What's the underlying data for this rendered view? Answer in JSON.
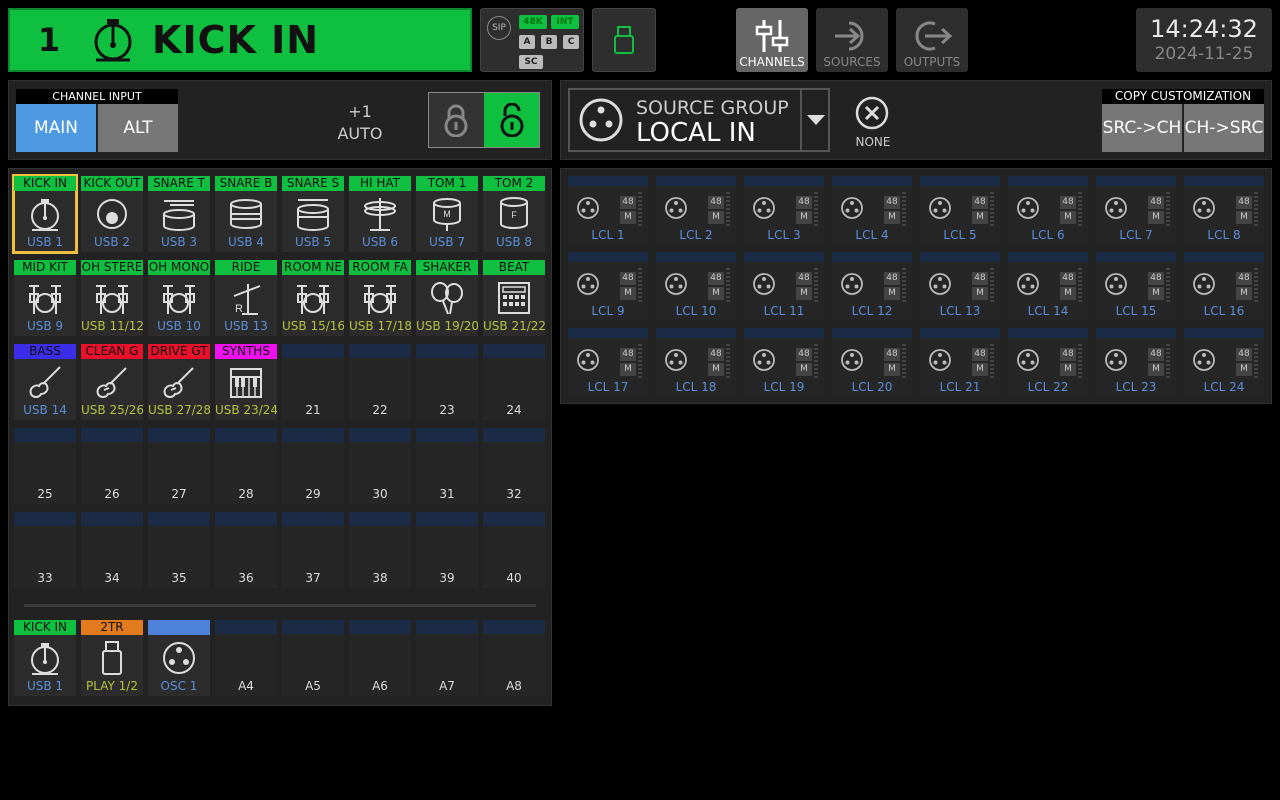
{
  "header": {
    "channel_number": "1",
    "channel_name": "KICK IN",
    "channel_icon": "kick-drum-icon",
    "sip": {
      "label": "SIP",
      "rate": "48K",
      "clock": "INT",
      "a": "A",
      "b": "B",
      "c": "C",
      "sc": "SC"
    },
    "nav": [
      {
        "label": "CHANNELS",
        "icon": "faders-icon",
        "active": true
      },
      {
        "label": "SOURCES",
        "icon": "source-arrow-icon",
        "active": false
      },
      {
        "label": "OUTPUTS",
        "icon": "output-arrow-icon",
        "active": false
      }
    ],
    "time": "14:24:32",
    "date": "2024-11-25"
  },
  "channel_input": {
    "label": "CHANNEL INPUT",
    "main": "MAIN",
    "alt": "ALT",
    "trim": "+1",
    "mode": "AUTO"
  },
  "source_group": {
    "label": "SOURCE GROUP",
    "value": "LOCAL IN",
    "none": "NONE"
  },
  "copy": {
    "label": "COPY CUSTOMIZATION",
    "src_to_ch": "SRC->CH",
    "ch_to_src": "CH->SRC"
  },
  "channels": [
    {
      "name": "KICK IN",
      "source": "USB 1",
      "color": "#0fbf3f",
      "icon": "kick-drum-icon",
      "selected": true
    },
    {
      "name": "KICK OUT",
      "source": "USB 2",
      "color": "#0fbf3f",
      "icon": "kick-drum-out-icon"
    },
    {
      "name": "SNARE T",
      "source": "USB 3",
      "color": "#0fbf3f",
      "icon": "snare-top-icon"
    },
    {
      "name": "SNARE B",
      "source": "USB 4",
      "color": "#0fbf3f",
      "icon": "snare-bottom-icon"
    },
    {
      "name": "SNARE S",
      "source": "USB 5",
      "color": "#0fbf3f",
      "icon": "snare-side-icon"
    },
    {
      "name": "HI HAT",
      "source": "USB 6",
      "color": "#0fbf3f",
      "icon": "hihat-icon"
    },
    {
      "name": "TOM 1",
      "source": "USB 7",
      "color": "#0fbf3f",
      "icon": "tom-m-icon"
    },
    {
      "name": "TOM 2",
      "source": "USB 8",
      "color": "#0fbf3f",
      "icon": "tom-f-icon"
    },
    {
      "name": "MID KIT",
      "source": "USB 9",
      "color": "#0fbf3f",
      "icon": "drumkit-icon"
    },
    {
      "name": "OH STERE",
      "source": "USB 11/12",
      "color": "#0fbf3f",
      "icon": "drumkit-icon",
      "stereo": true
    },
    {
      "name": "OH MONO",
      "source": "USB 10",
      "color": "#0fbf3f",
      "icon": "drumkit-icon"
    },
    {
      "name": "RIDE",
      "source": "USB 13",
      "color": "#0fbf3f",
      "icon": "ride-cymbal-icon"
    },
    {
      "name": "ROOM NE",
      "source": "USB 15/16",
      "color": "#0fbf3f",
      "icon": "drumkit-icon",
      "stereo": true
    },
    {
      "name": "ROOM FA",
      "source": "USB 17/18",
      "color": "#0fbf3f",
      "icon": "drumkit-icon",
      "stereo": true
    },
    {
      "name": "SHAKER",
      "source": "USB 19/20",
      "color": "#0fbf3f",
      "icon": "maracas-icon",
      "stereo": true
    },
    {
      "name": "BEAT",
      "source": "USB 21/22",
      "color": "#0fbf3f",
      "icon": "drum-machine-icon",
      "stereo": true
    },
    {
      "name": "BASS",
      "source": "USB 14",
      "color": "#3b2de8",
      "icon": "bass-guitar-icon"
    },
    {
      "name": "CLEAN G",
      "source": "USB 25/26",
      "color": "#e8102a",
      "icon": "electric-guitar-icon",
      "stereo": true
    },
    {
      "name": "DRIVE GT",
      "source": "USB 27/28",
      "color": "#e8102a",
      "icon": "electric-guitar-icon",
      "stereo": true
    },
    {
      "name": "SYNTHS",
      "source": "USB 23/24",
      "color": "#ee10ee",
      "icon": "keyboard-icon",
      "stereo": true
    },
    {
      "number": "21"
    },
    {
      "number": "22"
    },
    {
      "number": "23"
    },
    {
      "number": "24"
    },
    {
      "number": "25"
    },
    {
      "number": "26"
    },
    {
      "number": "27"
    },
    {
      "number": "28"
    },
    {
      "number": "29"
    },
    {
      "number": "30"
    },
    {
      "number": "31"
    },
    {
      "number": "32"
    },
    {
      "number": "33"
    },
    {
      "number": "34"
    },
    {
      "number": "35"
    },
    {
      "number": "36"
    },
    {
      "number": "37"
    },
    {
      "number": "38"
    },
    {
      "number": "39"
    },
    {
      "number": "40"
    }
  ],
  "aux_channels": [
    {
      "name": "KICK IN",
      "source": "USB 1",
      "color": "#0fbf3f",
      "icon": "kick-drum-icon"
    },
    {
      "name": "2TR",
      "source": "PLAY 1/2",
      "color": "#e27a1e",
      "icon": "usb-stick-icon",
      "stereo": true
    },
    {
      "name": "",
      "source": "OSC 1",
      "color": "#4d82d8",
      "icon": "xlr-icon"
    },
    {
      "number": "A4"
    },
    {
      "number": "A5"
    },
    {
      "number": "A6"
    },
    {
      "number": "A7"
    },
    {
      "number": "A8"
    }
  ],
  "sources": {
    "phantom_label": "48",
    "mute_label": "M",
    "items": [
      "LCL 1",
      "LCL 2",
      "LCL 3",
      "LCL 4",
      "LCL 5",
      "LCL 6",
      "LCL 7",
      "LCL 8",
      "LCL 9",
      "LCL 10",
      "LCL 11",
      "LCL 12",
      "LCL 13",
      "LCL 14",
      "LCL 15",
      "LCL 16",
      "LCL 17",
      "LCL 18",
      "LCL 19",
      "LCL 20",
      "LCL 21",
      "LCL 22",
      "LCL 23",
      "LCL 24"
    ]
  }
}
